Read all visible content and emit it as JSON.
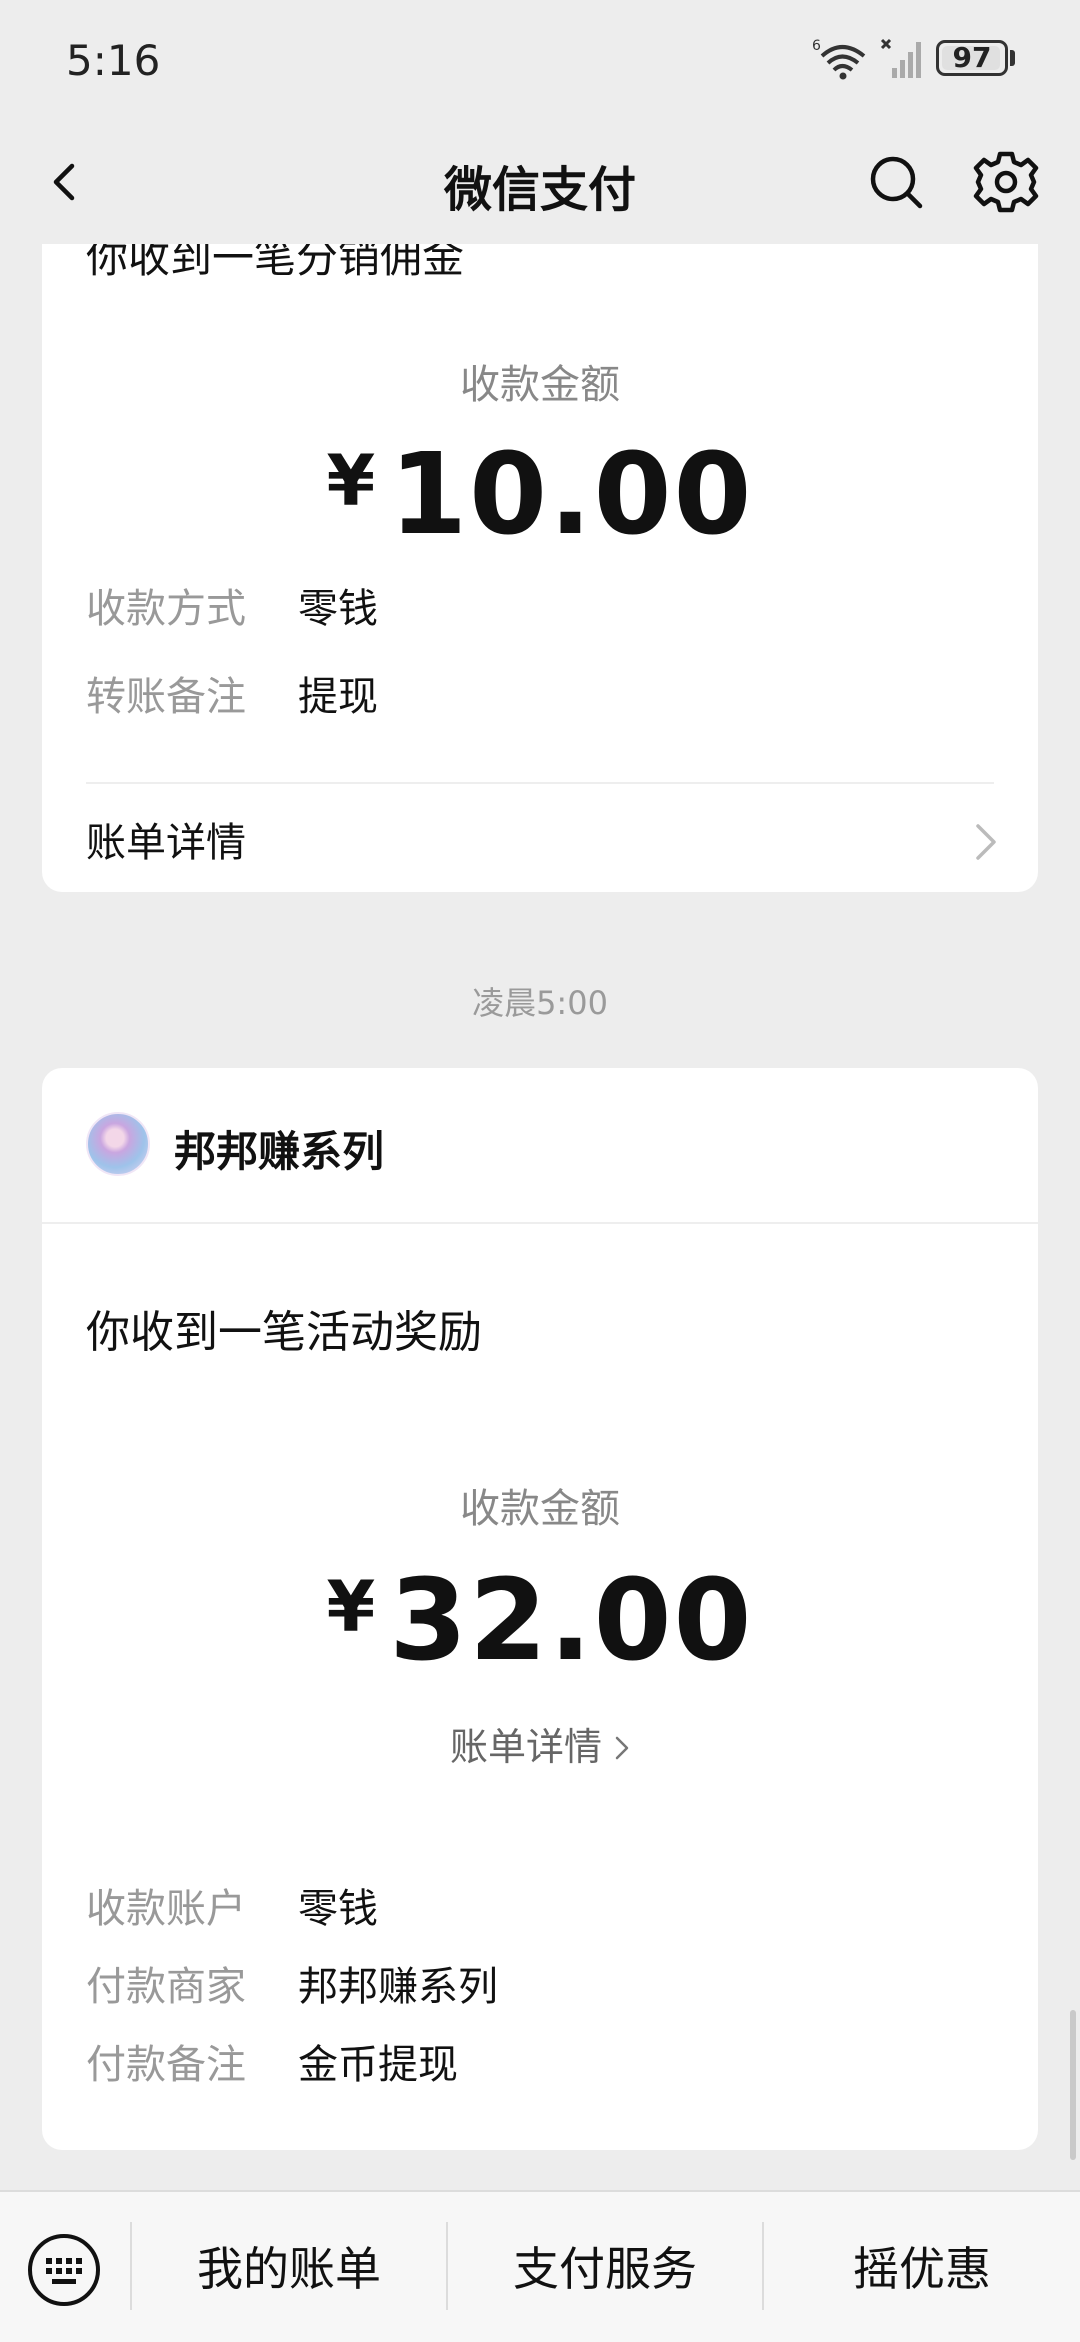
{
  "status_bar": {
    "time": "5:16",
    "battery": "97",
    "battery_level": 0.97
  },
  "nav": {
    "title": "微信支付"
  },
  "card1": {
    "title": "你收到一笔分销佣金",
    "amount_label": "收款金额",
    "currency": "¥",
    "amount": "10.00",
    "rows": [
      {
        "label": "收款方式",
        "value": "零钱"
      },
      {
        "label": "转账备注",
        "value": "提现"
      }
    ],
    "detail_label": "账单详情"
  },
  "timestamp": "凌晨5:00",
  "card2": {
    "merchant_name": "邦邦赚系列",
    "title": "你收到一笔活动奖励",
    "amount_label": "收款金额",
    "currency": "¥",
    "amount": "32.00",
    "detail_link": "账单详情",
    "rows": [
      {
        "label": "收款账户",
        "value": "零钱"
      },
      {
        "label": "付款商家",
        "value": "邦邦赚系列"
      },
      {
        "label": "付款备注",
        "value": "金币提现"
      }
    ]
  },
  "bottom_bar": {
    "tabs": [
      {
        "label": "我的账单"
      },
      {
        "label": "支付服务"
      },
      {
        "label": "摇优惠"
      }
    ]
  },
  "colors": {
    "background": "#ededed",
    "card": "#ffffff",
    "label_gray": "#999999",
    "text": "#111111"
  }
}
